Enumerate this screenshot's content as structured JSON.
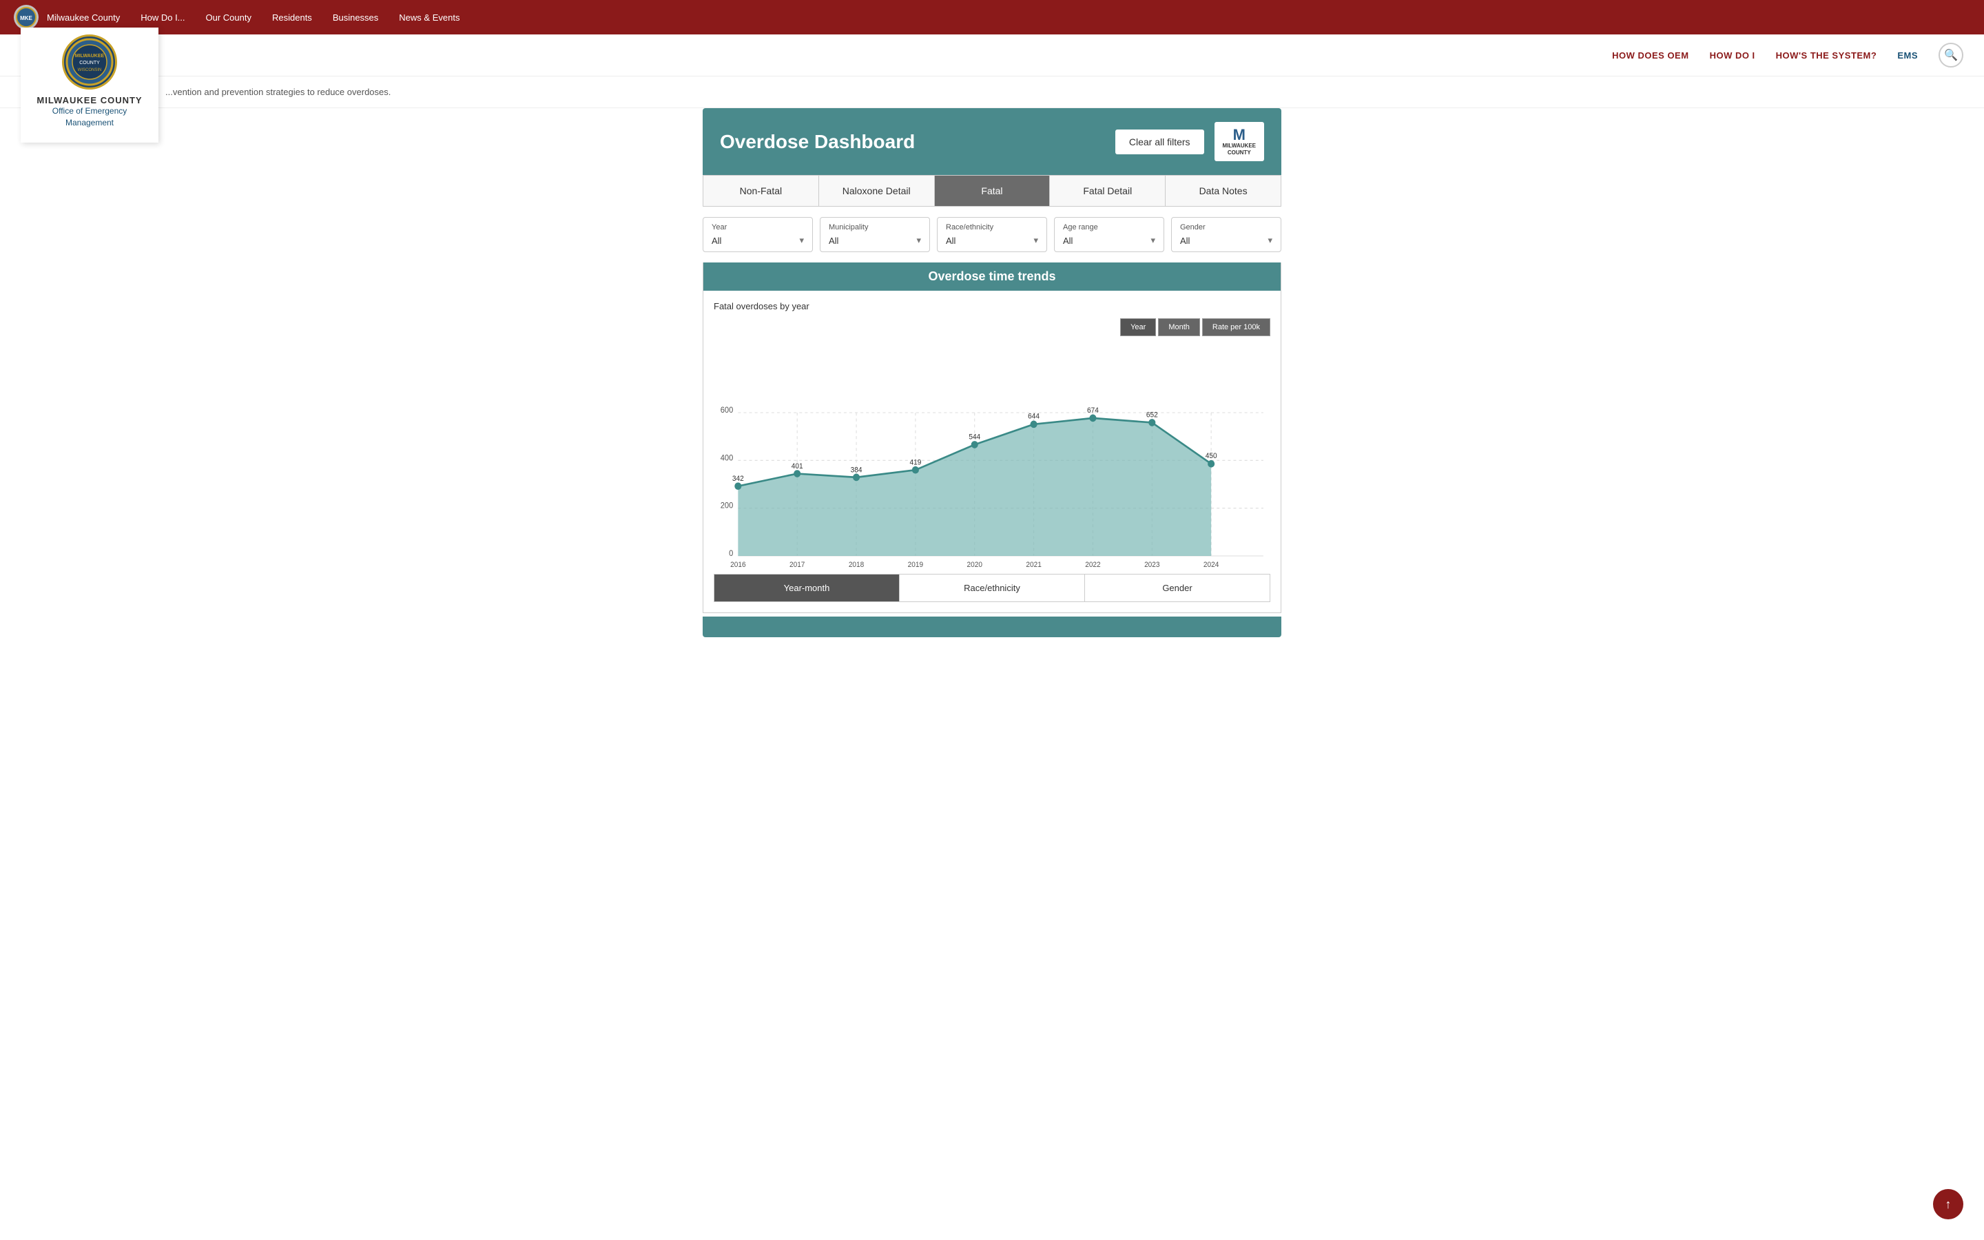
{
  "topNav": {
    "links": [
      "Milwaukee County",
      "How Do I...",
      "Our County",
      "Residents",
      "Businesses",
      "News & Events"
    ]
  },
  "secondaryNav": {
    "links": [
      {
        "label": "HOW DOES OEM",
        "href": "#"
      },
      {
        "label": "HOW DO I",
        "href": "#"
      },
      {
        "label": "HOW'S THE SYSTEM?",
        "href": "#"
      },
      {
        "label": "EMS",
        "href": "#",
        "class": "ems"
      }
    ]
  },
  "logo": {
    "countyName": "MILWAUKEE COUNTY",
    "oemLine1": "Office of Emergency",
    "oemLine2": "Management"
  },
  "bannerText": "...vention and prevention strategies to reduce overdoses.",
  "dashboard": {
    "title": "Overdose Dashboard",
    "clearFiltersLabel": "Clear all filters",
    "milwaukeeLogoM": "M",
    "milwaukeeLogoText": "MILWAUKEE\nCOUNTY"
  },
  "tabs": [
    {
      "label": "Non-Fatal",
      "active": false
    },
    {
      "label": "Naloxone Detail",
      "active": false
    },
    {
      "label": "Fatal",
      "active": true
    },
    {
      "label": "Fatal Detail",
      "active": false
    },
    {
      "label": "Data Notes",
      "active": false
    }
  ],
  "filters": [
    {
      "label": "Year",
      "value": "All"
    },
    {
      "label": "Municipality",
      "value": "All"
    },
    {
      "label": "Race/ethnicity",
      "value": "All"
    },
    {
      "label": "Age range",
      "value": "All"
    },
    {
      "label": "Gender",
      "value": "All"
    }
  ],
  "chart": {
    "sectionTitle": "Overdose time trends",
    "subtitle": "Fatal overdoses by year",
    "buttons": [
      "Year",
      "Month",
      "Rate per 100k"
    ],
    "activeButton": "Year",
    "data": [
      {
        "year": "2016",
        "value": 342
      },
      {
        "year": "2017",
        "value": 401
      },
      {
        "year": "2018",
        "value": 384
      },
      {
        "year": "2019",
        "value": 419
      },
      {
        "year": "2020",
        "value": 544
      },
      {
        "year": "2021",
        "value": 644
      },
      {
        "year": "2022",
        "value": 674
      },
      {
        "year": "2023",
        "value": 652
      },
      {
        "year": "2024",
        "value": 450
      }
    ],
    "yAxisLabels": [
      "0",
      "200",
      "400",
      "600"
    ],
    "fillColor": "#6aadaa",
    "strokeColor": "#3a8a87"
  },
  "bottomTabs": [
    {
      "label": "Year-month",
      "active": true
    },
    {
      "label": "Race/ethnicity",
      "active": false
    },
    {
      "label": "Gender",
      "active": false
    }
  ]
}
